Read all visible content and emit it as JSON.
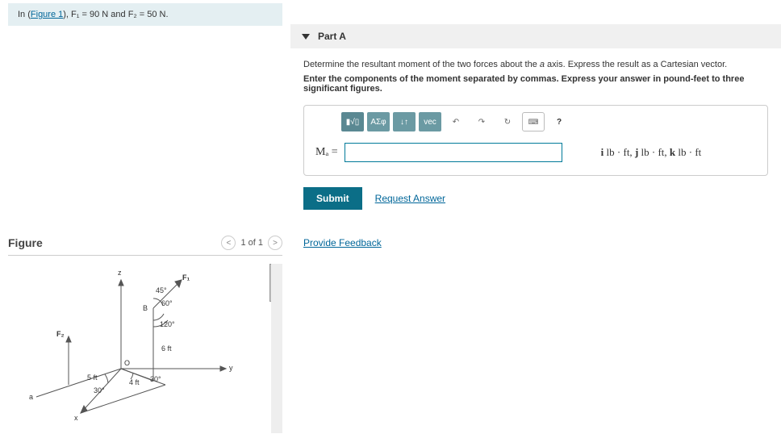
{
  "given": {
    "prefix": "In (",
    "figlink": "Figure 1",
    "suffix": "), F₁ = 90 N and F₂ = 50 N."
  },
  "figure": {
    "title": "Figure",
    "nav_prev": "<",
    "nav_text": "1 of 1",
    "nav_next": ">",
    "labels": {
      "z": "z",
      "y": "y",
      "x": "x",
      "a": "a",
      "O": "O",
      "B": "B",
      "F1": "F₁",
      "F2": "F₂",
      "ang45": "45°",
      "ang60": "60°",
      "ang120": "120°",
      "len6ft": "6 ft",
      "len5ft": "5 ft",
      "len4ft": "4 ft",
      "ang30a": "30°",
      "ang30b": "30°"
    }
  },
  "part": {
    "title": "Part A",
    "instr1_a": "Determine the resultant moment of the two forces about the ",
    "instr1_axis": "a",
    "instr1_b": " axis. Express the result as a Cartesian vector.",
    "instr2": "Enter the components of the moment separated by commas. Express your answer in pound-feet to three significant figures.",
    "toolbar": {
      "templates": "▮√▯",
      "greek": "ΑΣφ",
      "arrows": "↓↑",
      "vec": "vec",
      "undo": "↶",
      "redo": "↷",
      "reset": "↻",
      "keyboard": "⌨",
      "help": "?"
    },
    "lhs": "Mₐ =",
    "units": "i lb · ft, j lb · ft, k lb · ft",
    "submit": "Submit",
    "request": "Request Answer"
  },
  "feedback": "Provide Feedback"
}
